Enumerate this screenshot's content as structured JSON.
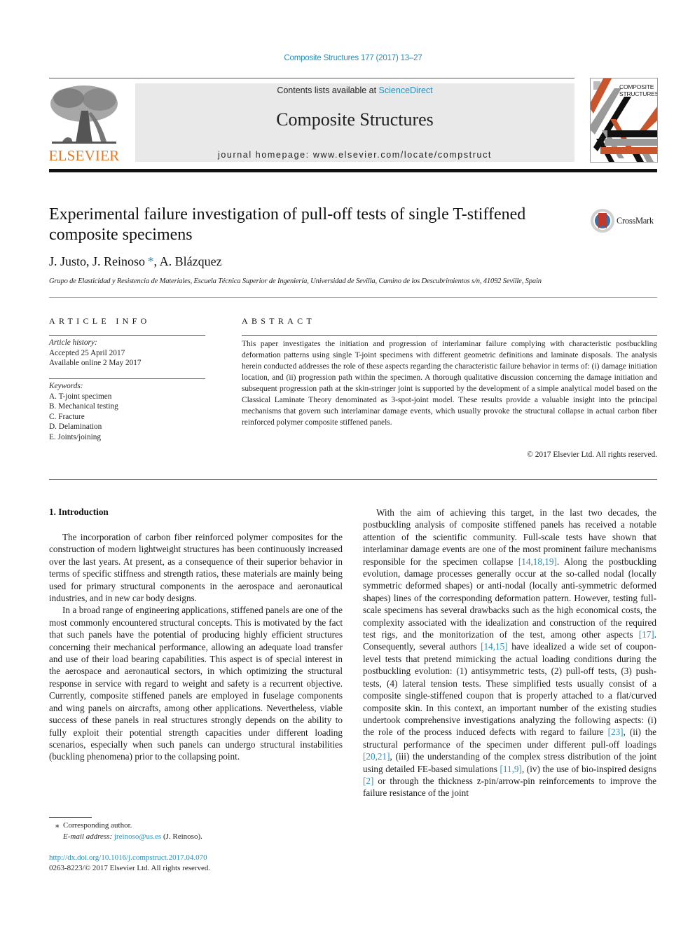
{
  "header": {
    "journal_reference": "Composite Structures 177 (2017) 13–27",
    "contents_prefix": "Contents lists available at ",
    "contents_link": "ScienceDirect",
    "journal_title": "Composite Structures",
    "homepage_prefix": "journal homepage: ",
    "homepage_url": "www.elsevier.com/locate/compstruct",
    "publisher_logo_text": "ELSEVIER",
    "cover_title_line1": "COMPOSITE",
    "cover_title_line2": "STRUCTURES",
    "colors": {
      "link": "#2a8db8",
      "elsevier_orange": "#e87722",
      "cover_orange": "#c8552b",
      "banner_bg": "#e9e9e9"
    }
  },
  "article": {
    "title": "Experimental failure investigation of pull-off tests of single T-stiffened composite specimens",
    "crossmark_label": "CrossMark",
    "authors": [
      {
        "name": "J. Justo",
        "corresponding": false
      },
      {
        "name": "J. Reinoso",
        "corresponding": true
      },
      {
        "name": "A. Blázquez",
        "corresponding": false
      }
    ],
    "affiliation": "Grupo de Elasticidad y Resistencia de Materiales, Escuela Técnica Superior de Ingeniería, Universidad de Sevilla, Camino de los Descubrimientos s/n, 41092 Seville, Spain"
  },
  "article_info": {
    "heading": "ARTICLE INFO",
    "history_label": "Article history:",
    "accepted": "Accepted 25 April 2017",
    "available_online": "Available online 2 May 2017",
    "keywords_label": "Keywords:",
    "keywords": [
      "A. T-joint specimen",
      "B. Mechanical testing",
      "C. Fracture",
      "D. Delamination",
      "E. Joints/joining"
    ]
  },
  "abstract": {
    "heading": "ABSTRACT",
    "text": "This paper investigates the initiation and progression of interlaminar failure complying with character­istic postbuckling deformation patterns using single T-joint specimens with different geometric defini­tions and laminate disposals. The analysis herein conducted addresses the role of these aspects regarding the characteristic failure behavior in terms of: (i) damage initiation location, and (ii) progres­sion path within the specimen. A thorough qualitative discussion concerning the damage initiation and subsequent progression path at the skin-stringer joint is supported by the development of a simple ana­lytical model based on the Classical Laminate Theory denominated as 3-spot-joint model. These results provide a valuable insight into the principal mechanisms that govern such interlaminar damage events, which usually provoke the structural collapse in actual carbon fiber reinforced polymer composite stiff­ened panels.",
    "copyright": "© 2017 Elsevier Ltd. All rights reserved."
  },
  "body": {
    "section_heading": "1. Introduction",
    "left_paragraphs": [
      "The incorporation of carbon fiber reinforced polymer compos­ites for the construction of modern lightweight structures has been continuously increased over the last years. At present, as a conse­quence of their superior behavior in terms of specific stiffness and strength ratios, these materials are mainly being used for primary structural components in the aerospace and aeronautical indus­tries, and in new car body designs.",
      "In a broad range of engineering applications, stiffened panels are one of the most commonly encountered structural concepts. This is motivated by the fact that such panels have the potential of producing highly efficient structures concerning their mechani­cal performance, allowing an adequate load transfer and use of their load bearing capabilities. This aspect is of special interest in the aerospace and aeronautical sectors, in which optimizing the structural response in service with regard to weight and safety is a recurrent objective. Currently, composite stiffened panels are employed in fuselage components and wing panels on aircrafts, among other applications. Nevertheless, viable success of these panels in real structures strongly depends on the ability to fully exploit their potential strength capacities under different loading scenarios, especially when such panels can undergo structural instabilities (buckling phenomena) prior to the collapsing point."
    ],
    "right_paragraph_segments": [
      {
        "text": "With the aim of achieving this target, in the last two decades, the postbuckling analysis of composite stiffened panels has received a notable attention of the scientific community. Full-scale tests have shown that interlaminar damage events are one of the most promi­nent failure mechanisms responsible for the specimen collapse ",
        "ref": false
      },
      {
        "text": "[14,18,19]",
        "ref": true
      },
      {
        "text": ". Along the postbuckling evolution, damage processes generally occur at the so-called nodal (locally symmetric deformed shapes) or anti-nodal (locally anti-symmetric deformed shapes) lines of the corresponding deformation pattern. However, testing full-scale specimens has several drawbacks such as the high economical costs, the complexity associated with the idealization and construction of the required test rigs, and the monitorization of the test, among other aspects ",
        "ref": false
      },
      {
        "text": "[17]",
        "ref": true
      },
      {
        "text": ". Consequently, several authors ",
        "ref": false
      },
      {
        "text": "[14,15]",
        "ref": true
      },
      {
        "text": " have idealized a wide set of coupon-level tests that pretend mimicking the actual loading conditions during the postbuckling evolution: (1) antisymmetric tests, (2) pull-off tests, (3) push-tests, (4) lateral tension tests. These simplified tests usually consist of a composite single-stiffened coupon that is properly attached to a flat/curved composite skin. In this context, an important number of the existing studies undertook comprehensive investigations analyzing the following aspects: (i) the role of the process induced defects with regard to failure ",
        "ref": false
      },
      {
        "text": "[23]",
        "ref": true
      },
      {
        "text": ", (ii) the structural performance of the specimen under different pull-off loadings ",
        "ref": false
      },
      {
        "text": "[20,21]",
        "ref": true
      },
      {
        "text": ", (iii) the understanding of the complex stress distribution of the joint using detailed FE-based simulations ",
        "ref": false
      },
      {
        "text": "[11,9]",
        "ref": true
      },
      {
        "text": ", (iv) the use of bio-inspired designs ",
        "ref": false
      },
      {
        "text": "[2]",
        "ref": true
      },
      {
        "text": " or through the thickness z-pin/arrow-pin reinforcements to improve the failure resistance of the joint",
        "ref": false
      }
    ]
  },
  "footnote": {
    "marker": "⁎",
    "corresponding_label": "Corresponding author.",
    "email_label": "E-mail address:",
    "email": "jreinoso@us.es",
    "email_owner": "(J. Reinoso)."
  },
  "doi": {
    "url": "http://dx.doi.org/10.1016/j.compstruct.2017.04.070",
    "issn_line": "0263-8223/© 2017 Elsevier Ltd. All rights reserved."
  }
}
